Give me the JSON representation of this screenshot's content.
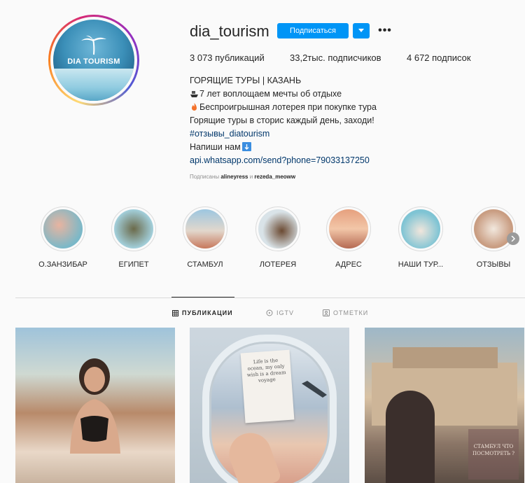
{
  "profile": {
    "username": "dia_tourism",
    "avatar_brand": "DIA TOURISM",
    "follow_label": "Подписаться",
    "more_label": "•••"
  },
  "stats": {
    "posts": "3 073 публикаций",
    "followers": "33,2тыс. подписчиков",
    "following": "4 672 подписок"
  },
  "bio": {
    "title": "ГОРЯЩИЕ ТУРЫ | КАЗАНЬ",
    "line1": "7 лет воплощаем мечты об отдыхе",
    "line2": "Беспроигрышная лотерея при покупке тура",
    "line3": "Горящие туры в сторис каждый день, заходи!",
    "hashtag": "#отзывы_diatourism",
    "line5": "Напиши нам",
    "link": "api.whatsapp.com/send?phone=79033137250"
  },
  "followed_by": {
    "prefix": "Подписаны",
    "user1": "alineyress",
    "sep": "и",
    "user2": "rezeda_meoww"
  },
  "highlights": [
    {
      "label": "О.ЗАНЗИБАР"
    },
    {
      "label": "ЕГИПЕТ"
    },
    {
      "label": "СТАМБУЛ"
    },
    {
      "label": "ЛОТЕРЕЯ"
    },
    {
      "label": "АДРЕС"
    },
    {
      "label": "НАШИ ТУР..."
    },
    {
      "label": "ОТЗЫВЫ"
    }
  ],
  "tabs": {
    "posts": "ПУБЛИКАЦИИ",
    "igtv": "IGTV",
    "tagged": "ОТМЕТКИ"
  },
  "posts": {
    "note_text": "Life is the ocean, my only wish is a dream voyage",
    "post3_caption": "СТАМБУЛ ЧТО ПОСМОТРЕТЬ ?"
  },
  "colors": {
    "accent": "#0095f6",
    "link": "#00376b",
    "muted": "#8e8e8e"
  }
}
